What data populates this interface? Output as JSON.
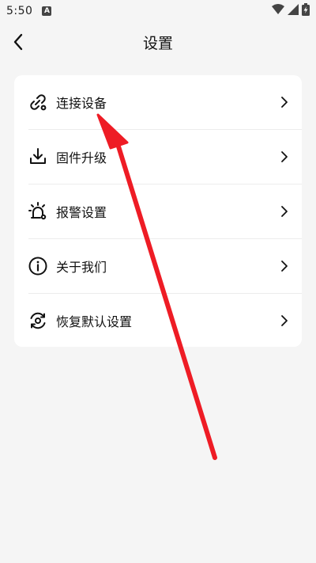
{
  "status_bar": {
    "time": "5:50",
    "notification_glyph": "A",
    "icons": [
      "wifi-icon",
      "signal-icon",
      "battery-charging-icon"
    ]
  },
  "header": {
    "title": "设置",
    "back_icon": "chevron-left-icon"
  },
  "settings": {
    "items": [
      {
        "label": "连接设备",
        "icon": "link-gear-icon"
      },
      {
        "label": "固件升级",
        "icon": "download-icon"
      },
      {
        "label": "报警设置",
        "icon": "alarm-light-icon"
      },
      {
        "label": "关于我们",
        "icon": "info-icon"
      },
      {
        "label": "恢复默认设置",
        "icon": "reset-icon"
      }
    ]
  },
  "colors": {
    "background": "#f5f5f5",
    "card": "#ffffff",
    "annotation_arrow": "#ee1c25"
  }
}
